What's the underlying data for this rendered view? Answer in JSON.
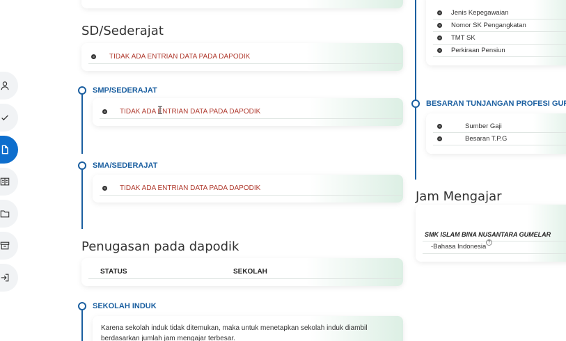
{
  "left_column": {
    "sd_title": "SD/Sederajat",
    "sd_empty": "TIDAK ADA ENTRIAN DATA PADA DAPODIK",
    "smp_title": "SMP/SEDERAJAT",
    "smp_empty": "TIDAK ADA ENTRIAN DATA PADA DAPODIK",
    "sma_title": "SMA/SEDERAJAT",
    "sma_empty": "TIDAK ADA ENTRIAN DATA PADA DAPODIK",
    "penugasan_title": "Penugasan pada dapodik",
    "table_headers": [
      "STATUS",
      "SEKOLAH"
    ],
    "sekolah_induk_title": "SEKOLAH INDUK",
    "sekolah_induk_note": "Karena sekolah induk tidak ditemukan, maka untuk menetapkan sekolah induk diambil berdasarkan jumlah jam mengajar terbesar."
  },
  "right_column": {
    "kepegawaian_items": [
      "Jenis Kepegawaian",
      "Nomor SK Pengangkatan",
      "TMT SK",
      "Perkiraan Pensiun"
    ],
    "tunjangan_title": "BESARAN TUNJANGAN PROFESI GURU",
    "tunjangan_items": [
      "Sumber Gaji",
      "Besaran T.P.G"
    ],
    "jam_title": "Jam Mengajar",
    "school_name": "SMK ISLAM BINA NUSANTARA GUMELAR",
    "subject": "-Bahasa Indonesia",
    "help_glyph": "?"
  },
  "sidebar_icons": [
    "user-icon",
    "check-icon",
    "document-icon",
    "book-icon",
    "folder-icon",
    "archive-icon",
    "logout-icon"
  ],
  "colors": {
    "accent": "#1b5fa0",
    "active": "#0d6ecd",
    "empty_text": "#b03a2e"
  }
}
